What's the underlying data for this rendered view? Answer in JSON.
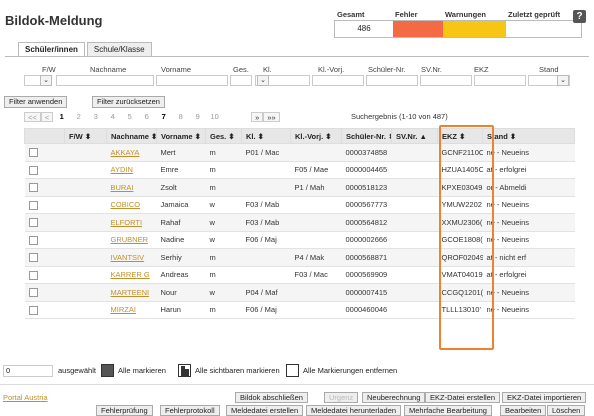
{
  "page": {
    "title": "Bildok-Meldung",
    "help_label": "?"
  },
  "status": {
    "headers": [
      "Gesamt",
      "Fehler",
      "Warnungen",
      "Zuletzt geprüft"
    ],
    "gesamt": "486",
    "colors": {
      "fehler": "#f26b45",
      "warnungen": "#f7c615"
    }
  },
  "tabs": [
    "Schüler/innen",
    "Schule/Klasse"
  ],
  "filter": {
    "labels": [
      "F/W",
      "Nachname",
      "Vorname",
      "Ges.",
      "Kl.",
      "Kl.-Vorj.",
      "Schüler-Nr.",
      "SV.Nr.",
      "EKZ",
      "Stand"
    ],
    "select_arrow": "⌄",
    "apply_label": "Filter anwenden",
    "reset_label": "Filter zurücksetzen"
  },
  "pager": {
    "first": "<<",
    "prev": "<",
    "pages": [
      "1",
      "2",
      "3",
      "4",
      "5",
      "6",
      "7",
      "8",
      "9",
      "10"
    ],
    "next": "»",
    "last": "»»",
    "result": "Suchergebnis (1-10 von 487)"
  },
  "table": {
    "headers": [
      "",
      "F/W ⬍",
      "Nachname ⬍",
      "Vorname ⬍",
      "Ges. ⬍",
      "Kl. ⬍",
      "Kl.-Vorj. ⬍",
      "Schüler-Nr. ⬍",
      "SV.Nr. ▲",
      "EKZ ⬍",
      "Stand ⬍"
    ],
    "rows": [
      [
        "",
        "",
        "AKKAYA",
        "Mert",
        "m",
        "P01 / Mac",
        "",
        "0000374858",
        "",
        "GCNF2110C",
        "ne - Neueins"
      ],
      [
        "",
        "",
        "AYDIN",
        "Emre",
        "m",
        "",
        "F05 / Mae",
        "0000004465",
        "",
        "HZUA1405C",
        "at - erfolgrei"
      ],
      [
        "",
        "",
        "BURAI",
        "Zsolt",
        "m",
        "",
        "P1 / Mah",
        "0000518123",
        "",
        "KPXE03049",
        "or - Abmeldi"
      ],
      [
        "",
        "",
        "COBICO",
        "Jamaica",
        "w",
        "F03 / Mab",
        "",
        "0000567773",
        "",
        "YMUW2202",
        "ne - Neueins"
      ],
      [
        "",
        "",
        "ELFORTI",
        "Rahaf",
        "w",
        "F03 / Mab",
        "",
        "0000564812",
        "",
        "XXMU2306(",
        "ne - Neueins"
      ],
      [
        "",
        "",
        "GRUBNER",
        "Nadine",
        "w",
        "F06 / Maj",
        "",
        "0000002666",
        "",
        "GCOE1808(",
        "ne - Neueins"
      ],
      [
        "",
        "",
        "IVANTSIV",
        "Serhiy",
        "m",
        "",
        "P4 / Mak",
        "0000568871",
        "",
        "QROF02049",
        "at - nicht erf"
      ],
      [
        "",
        "",
        "KARRER G",
        "Andreas",
        "m",
        "",
        "F03 / Mac",
        "0000569909",
        "",
        "VMAT04019",
        "at - erfolgrei"
      ],
      [
        "",
        "",
        "MARTEENI",
        "Nour",
        "w",
        "P04 / Maf",
        "",
        "0000007415",
        "",
        "CCGQ1201(",
        "ne - Neueins"
      ],
      [
        "",
        "",
        "MIRZAI",
        "Harun",
        "m",
        "F06 / Maj",
        "",
        "0000460046",
        "",
        "TLLL13010'",
        "ne - Neueins"
      ]
    ]
  },
  "selection": {
    "count": "0",
    "selected_label": "ausgewählt",
    "mark_all": "Alle markieren",
    "mark_visible": "Alle sichtbaren markieren",
    "remove_all": "Alle Markierungen entfernen"
  },
  "footer": {
    "portal": "Portal Austria",
    "row1": [
      "Bildok abschließen",
      "Urgenz",
      "Neuberechnung",
      "EKZ-Datei erstellen",
      "EKZ-Datei importieren"
    ],
    "row2": [
      "Fehlerprüfung",
      "Fehlerprotokoll",
      "Meldedatei erstellen",
      "Meldedatei herunterladen",
      "Mehrfache Bearbeitung",
      "Bearbeiten",
      "Löschen"
    ]
  }
}
